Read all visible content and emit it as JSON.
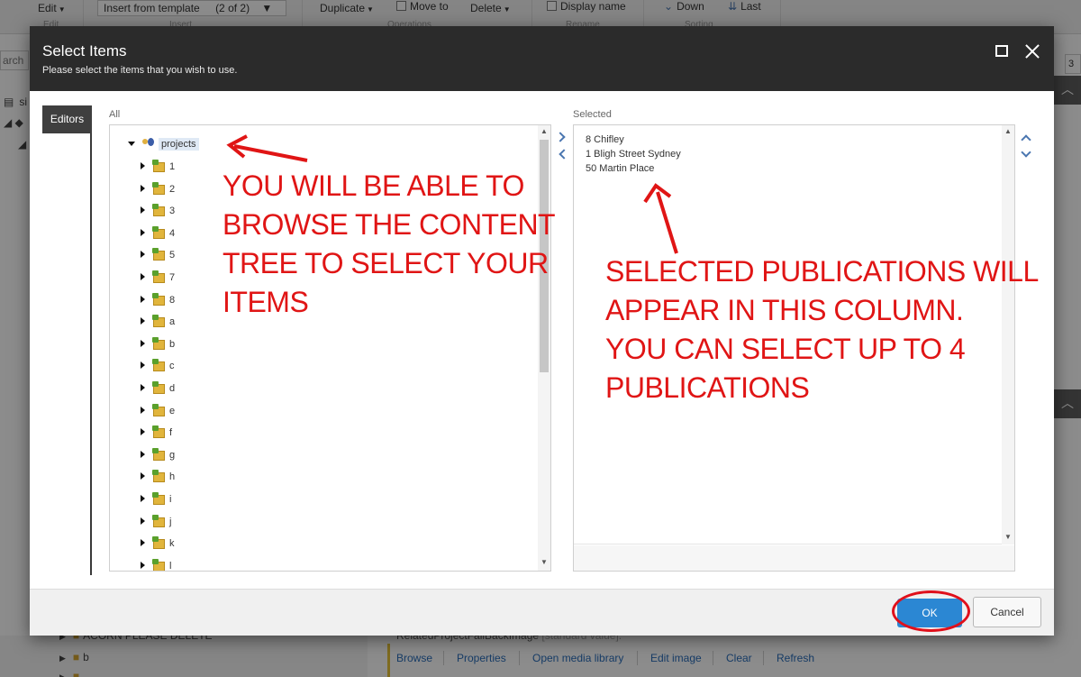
{
  "ribbon": {
    "edit_label": "Edit",
    "insert_template_label": "Insert from template",
    "insert_template_count": "(2 of 2)",
    "duplicate_label": "Duplicate",
    "move_to_label": "Move to",
    "delete_label": "Delete",
    "display_name_label": "Display name",
    "down_label": "Down",
    "last_label": "Last",
    "group_edit": "Edit",
    "group_insert": "Insert",
    "group_operations": "Operations",
    "group_rename": "Rename",
    "group_sorting": "Sorting"
  },
  "background": {
    "search_text": "arch",
    "tree_row1": "si",
    "right_box_text": "3",
    "bottom_item_a": "ACORN PLEASE DELETE",
    "bottom_item_b": "b",
    "field_title": "RelatedProjectFallBackImage",
    "field_title_suffix": "[standard value]:",
    "links": [
      "Browse",
      "Properties",
      "Open media library",
      "Edit image",
      "Clear",
      "Refresh"
    ]
  },
  "dialog": {
    "title": "Select Items",
    "subtitle": "Please select the items that you wish to use.",
    "side_tab": "Editors",
    "all_label": "All",
    "selected_label": "Selected",
    "ok_label": "OK",
    "cancel_label": "Cancel"
  },
  "tree": {
    "root": "projects",
    "items": [
      "1",
      "2",
      "3",
      "4",
      "5",
      "7",
      "8",
      "a",
      "b",
      "c",
      "d",
      "e",
      "f",
      "g",
      "h",
      "i",
      "j",
      "k",
      "l"
    ]
  },
  "selected_items": [
    "8 Chifley",
    "1 Bligh Street Sydney",
    "50 Martin Place"
  ],
  "annotations": {
    "left": [
      "YOU WILL BE ABLE TO",
      "BROWSE THE CONTENT",
      "TREE TO SELECT YOUR",
      "ITEMS"
    ],
    "right": [
      "SELECTED PUBLICATIONS WILL",
      "APPEAR IN THIS COLUMN.",
      "YOU CAN SELECT UP TO 4",
      "PUBLICATIONS"
    ]
  },
  "colors": {
    "header_bg": "#2b2b2b",
    "ok_blue": "#2b87d3",
    "annotation_red": "#e01515",
    "link_blue": "#2a6ebb"
  }
}
